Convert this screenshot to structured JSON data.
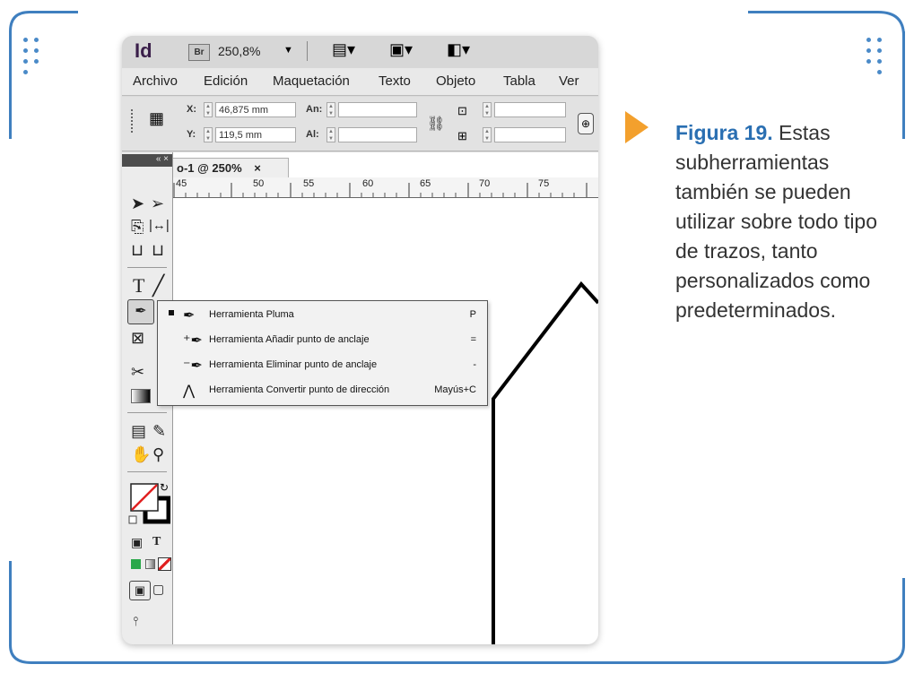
{
  "app": {
    "logo": "Id",
    "bridge_button": "Br",
    "zoom": "250,8%"
  },
  "menubar": [
    "Archivo",
    "Edición",
    "Maquetación",
    "Texto",
    "Objeto",
    "Tabla",
    "Ver"
  ],
  "control_panel": {
    "x_label": "X:",
    "x_value": "46,875 mm",
    "y_label": "Y:",
    "y_value": "119,5 mm",
    "w_label": "An:",
    "h_label": "Al:"
  },
  "document": {
    "tab_title": "o-1 @ 250%",
    "tab_close": "×",
    "ruler": [
      "45",
      "50",
      "55",
      "60",
      "65",
      "70",
      "75"
    ]
  },
  "toolbox": {
    "header": "« ×"
  },
  "flyout": {
    "items": [
      {
        "label": "Herramienta Pluma",
        "shortcut": "P",
        "selected": true,
        "icon": "pen-icon"
      },
      {
        "label": "Herramienta Añadir punto de anclaje",
        "shortcut": "=",
        "selected": false,
        "icon": "add-anchor-pen-icon"
      },
      {
        "label": "Herramienta Eliminar punto de anclaje",
        "shortcut": "-",
        "selected": false,
        "icon": "delete-anchor-pen-icon"
      },
      {
        "label": "Herramienta Convertir punto de dirección",
        "shortcut": "Mayús+C",
        "selected": false,
        "icon": "convert-point-icon"
      }
    ]
  },
  "caption": {
    "figure": "Figura 19.",
    "text": "Estas subherramientas también se pueden utilizar sobre todo tipo de trazos, tanto personalizados como predeterminados."
  },
  "colors": {
    "frame": "#3f7fbf",
    "arrow": "#f3a02d",
    "figure_label": "#2a6fb2"
  }
}
